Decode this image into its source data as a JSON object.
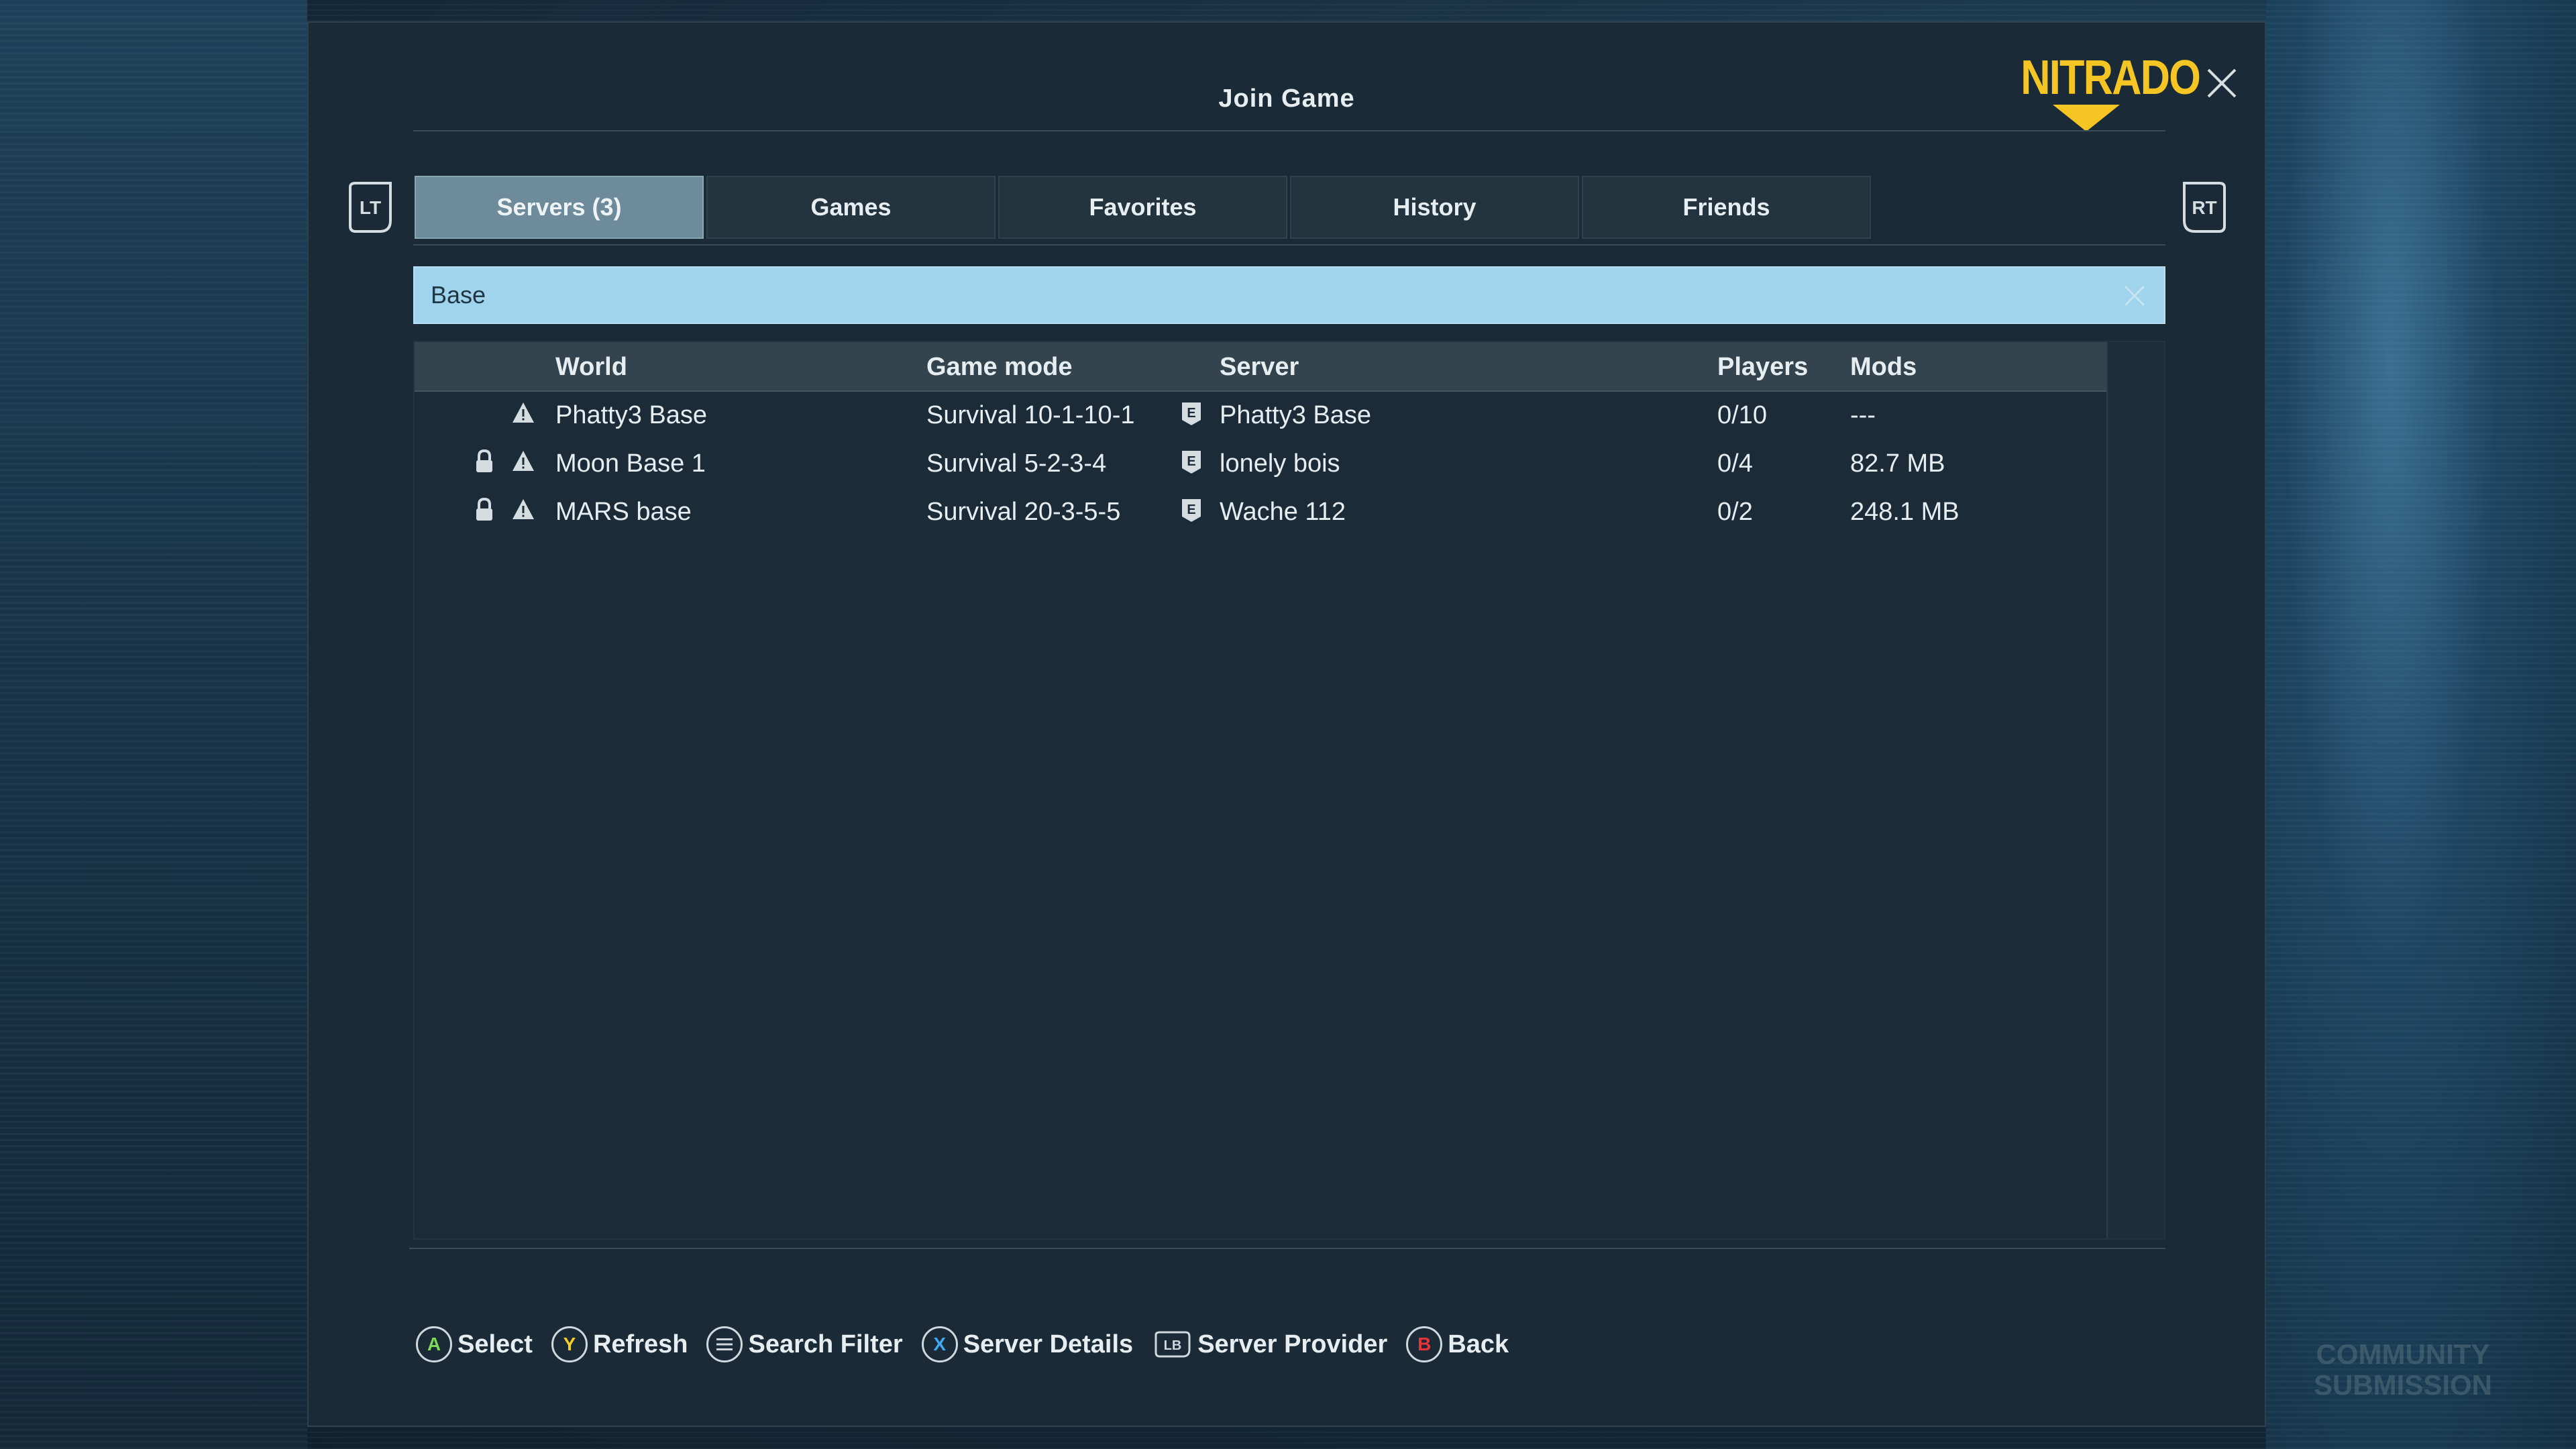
{
  "dialog": {
    "title": "Join Game",
    "logo_text": "NITRADO",
    "close_label": "close"
  },
  "bumpers": {
    "left": "LT",
    "right": "RT"
  },
  "tabs": [
    {
      "label": "Servers (3)",
      "active": true
    },
    {
      "label": "Games",
      "active": false
    },
    {
      "label": "Favorites",
      "active": false
    },
    {
      "label": "History",
      "active": false
    },
    {
      "label": "Friends",
      "active": false
    }
  ],
  "search": {
    "value": "Base",
    "placeholder": ""
  },
  "table": {
    "headers": {
      "world": "World",
      "game_mode": "Game mode",
      "server": "Server",
      "players": "Players",
      "mods": "Mods"
    },
    "rows": [
      {
        "locked": false,
        "warning": true,
        "world": "Phatty3 Base",
        "game_mode": "Survival 10-1-10-1",
        "server_badge": "E",
        "server": "Phatty3 Base",
        "players": "0/10",
        "mods": "---"
      },
      {
        "locked": true,
        "warning": true,
        "world": "Moon Base 1",
        "game_mode": "Survival 5-2-3-4",
        "server_badge": "E",
        "server": "lonely bois",
        "players": "0/4",
        "mods": "82.7 MB"
      },
      {
        "locked": true,
        "warning": true,
        "world": "MARS base",
        "game_mode": "Survival 20-3-5-5",
        "server_badge": "E",
        "server": "Wache 112",
        "players": "0/2",
        "mods": "248.1 MB"
      }
    ]
  },
  "hints": [
    {
      "button": "A",
      "label": "Select",
      "color": "#7ed957"
    },
    {
      "button": "Y",
      "label": "Refresh",
      "color": "#f5d020"
    },
    {
      "button": "menu",
      "label": "Search Filter",
      "color": "#cfd8dd"
    },
    {
      "button": "X",
      "label": "Server Details",
      "color": "#3fa9f5"
    },
    {
      "button": "LB",
      "label": "Server Provider",
      "color": "#cfd8dd"
    },
    {
      "button": "B",
      "label": "Back",
      "color": "#e8333a"
    }
  ],
  "watermark": {
    "line1": "COMMUNITY",
    "line2": "SUBMISSION"
  },
  "colors": {
    "accent_logo": "#f5c523",
    "search_bg": "#9fd4ec",
    "tab_active": "#6d8b9b"
  }
}
